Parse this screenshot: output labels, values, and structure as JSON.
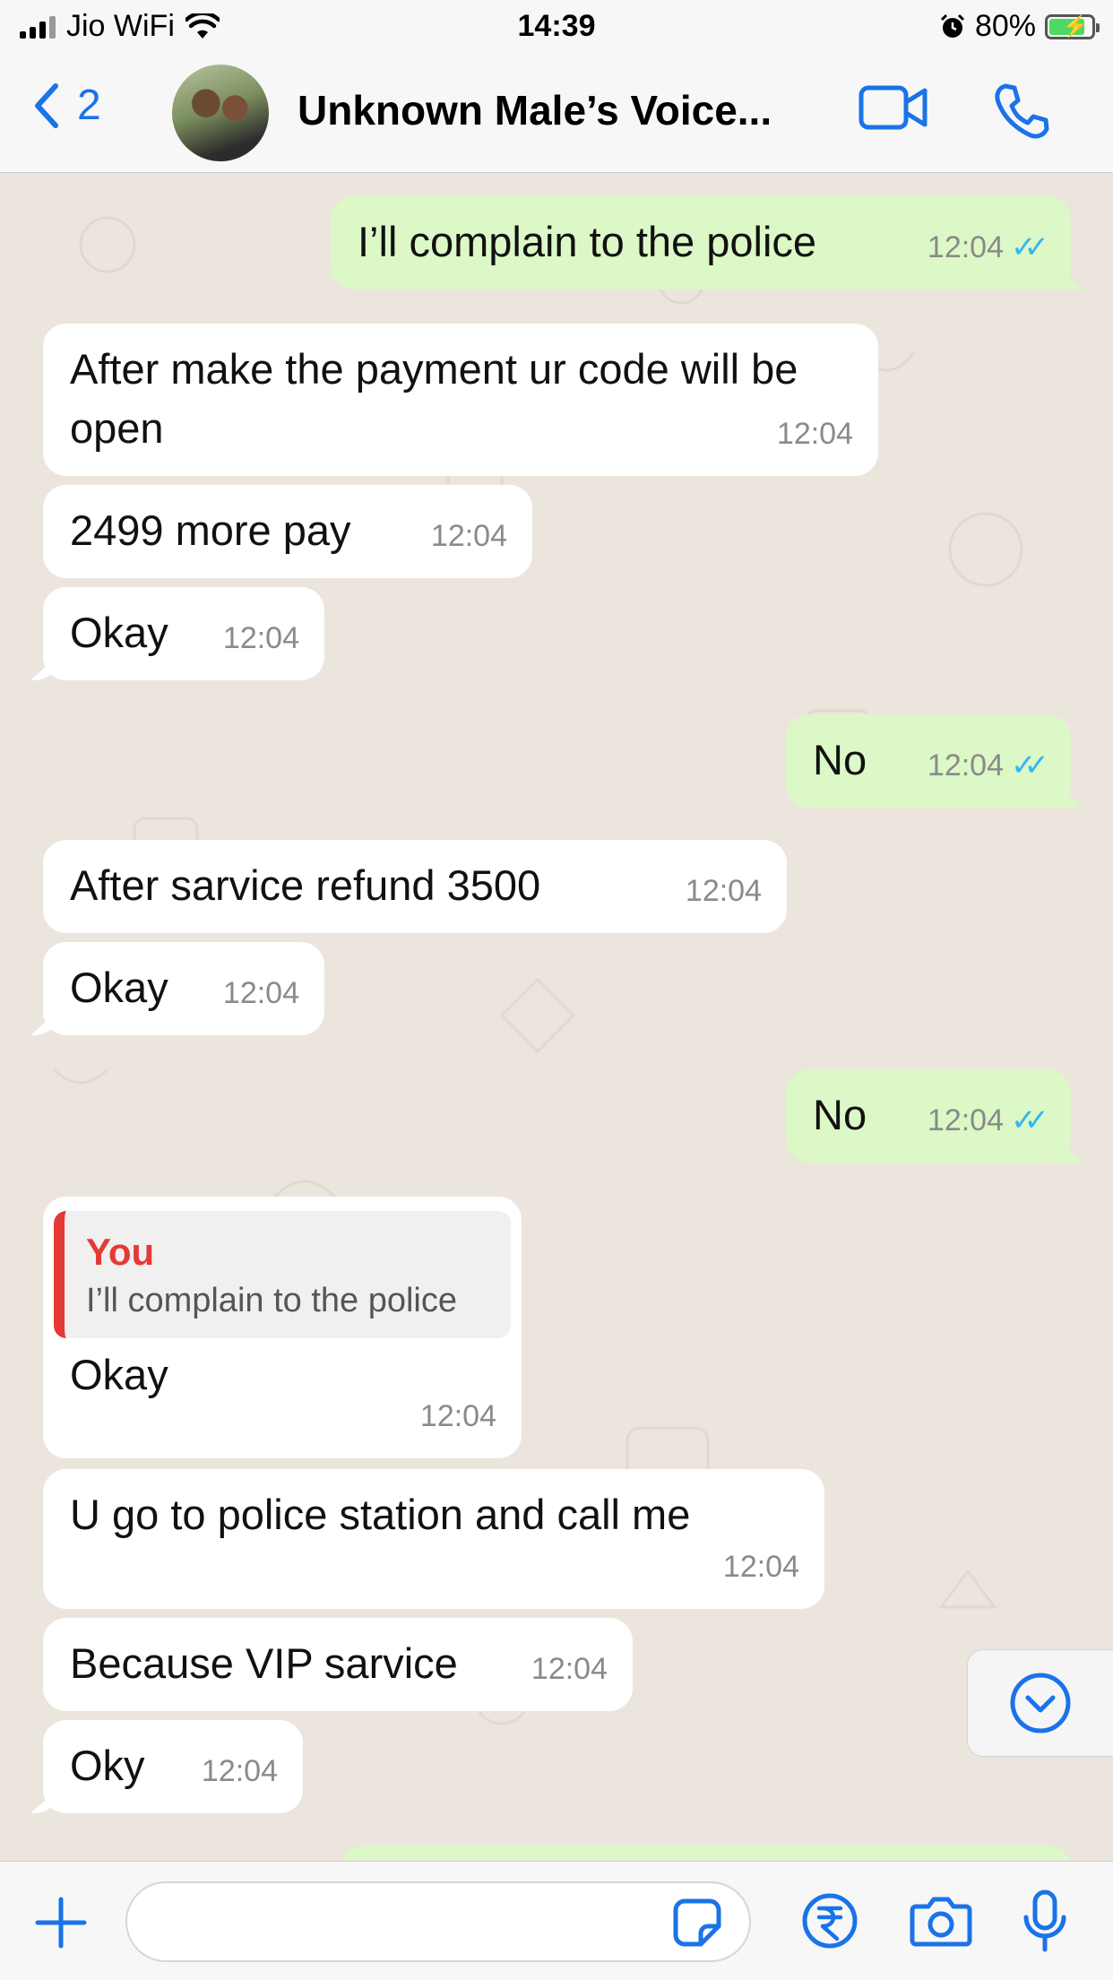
{
  "status_bar": {
    "carrier": "Jio WiFi",
    "time": "14:39",
    "battery": "80%"
  },
  "header": {
    "back_count": "2",
    "contact_name": "Unknown  Male’s Voice..."
  },
  "messages": [
    {
      "dir": "out",
      "text": "I’ll complain to the police",
      "time": "12:04"
    },
    {
      "dir": "in",
      "text": "After make the payment ur code will be open",
      "time": "12:04"
    },
    {
      "dir": "in",
      "text": "2499 more pay",
      "time": "12:04"
    },
    {
      "dir": "in",
      "text": "Okay",
      "time": "12:04"
    },
    {
      "dir": "out",
      "text": "No",
      "time": "12:04"
    },
    {
      "dir": "in",
      "text": "After sarvice refund 3500",
      "time": "12:04"
    },
    {
      "dir": "in",
      "text": "Okay",
      "time": "12:04"
    },
    {
      "dir": "out",
      "text": "No",
      "time": "12:04"
    },
    {
      "dir": "in",
      "text": "Okay",
      "time": "12:04",
      "quote": {
        "author": "You",
        "text": "I’ll complain to the police"
      }
    },
    {
      "dir": "in",
      "text": "U go to police station and call me",
      "time": "12:04"
    },
    {
      "dir": "in",
      "text": "Because VIP sarvice",
      "time": "12:04"
    },
    {
      "dir": "in",
      "text": "Oky",
      "time": "12:04"
    }
  ],
  "input": {
    "placeholder": ""
  },
  "colors": {
    "accent": "#1a73e8",
    "outgoing": "#dcf8c6",
    "incoming": "#ffffff",
    "read_ticks": "#34b7f1",
    "quote_bar": "#e53935"
  }
}
